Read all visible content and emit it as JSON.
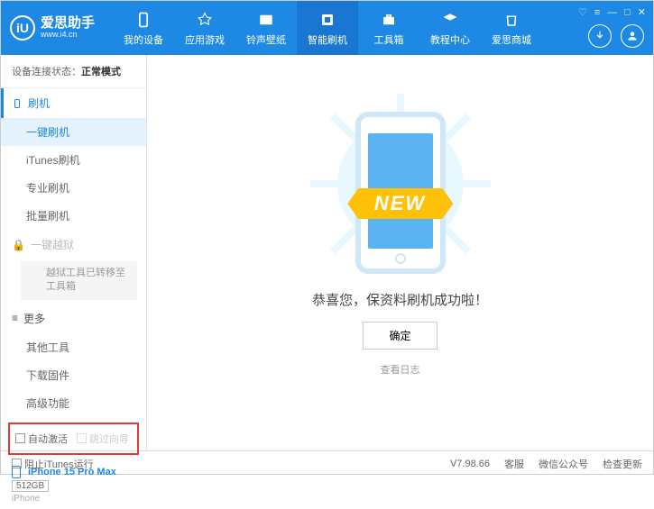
{
  "logo": {
    "icon": "iU",
    "title": "爱思助手",
    "sub": "www.i4.cn"
  },
  "nav": [
    {
      "label": "我的设备"
    },
    {
      "label": "应用游戏"
    },
    {
      "label": "铃声壁纸"
    },
    {
      "label": "智能刷机",
      "active": true
    },
    {
      "label": "工具箱"
    },
    {
      "label": "教程中心"
    },
    {
      "label": "爱思商城"
    }
  ],
  "sysbar": {
    "gift": "▼",
    "menu": "≡",
    "min": "—",
    "max": "□",
    "close": "✕"
  },
  "sidebar": {
    "conn_label": "设备连接状态：",
    "conn_value": "正常模式",
    "group_flash": "刷机",
    "items_flash": [
      {
        "label": "一键刷机",
        "active": true
      },
      {
        "label": "iTunes刷机"
      },
      {
        "label": "专业刷机"
      },
      {
        "label": "批量刷机"
      }
    ],
    "group_jailbreak": "一键越狱",
    "jailbreak_note": "越狱工具已转移至工具箱",
    "group_more": "更多",
    "items_more": [
      {
        "label": "其他工具"
      },
      {
        "label": "下载固件"
      },
      {
        "label": "高级功能"
      }
    ],
    "checks": {
      "auto_activate": "自动激活",
      "skip_guide": "跳过向导"
    },
    "device": {
      "name": "iPhone 15 Pro Max",
      "capacity": "512GB",
      "model": "iPhone"
    }
  },
  "main": {
    "banner": "NEW",
    "message": "恭喜您，保资料刷机成功啦！",
    "ok": "确定",
    "viewlog": "查看日志"
  },
  "footer": {
    "block_itunes": "阻止iTunes运行",
    "version": "V7.98.66",
    "links": [
      "客服",
      "微信公众号",
      "检查更新"
    ]
  }
}
